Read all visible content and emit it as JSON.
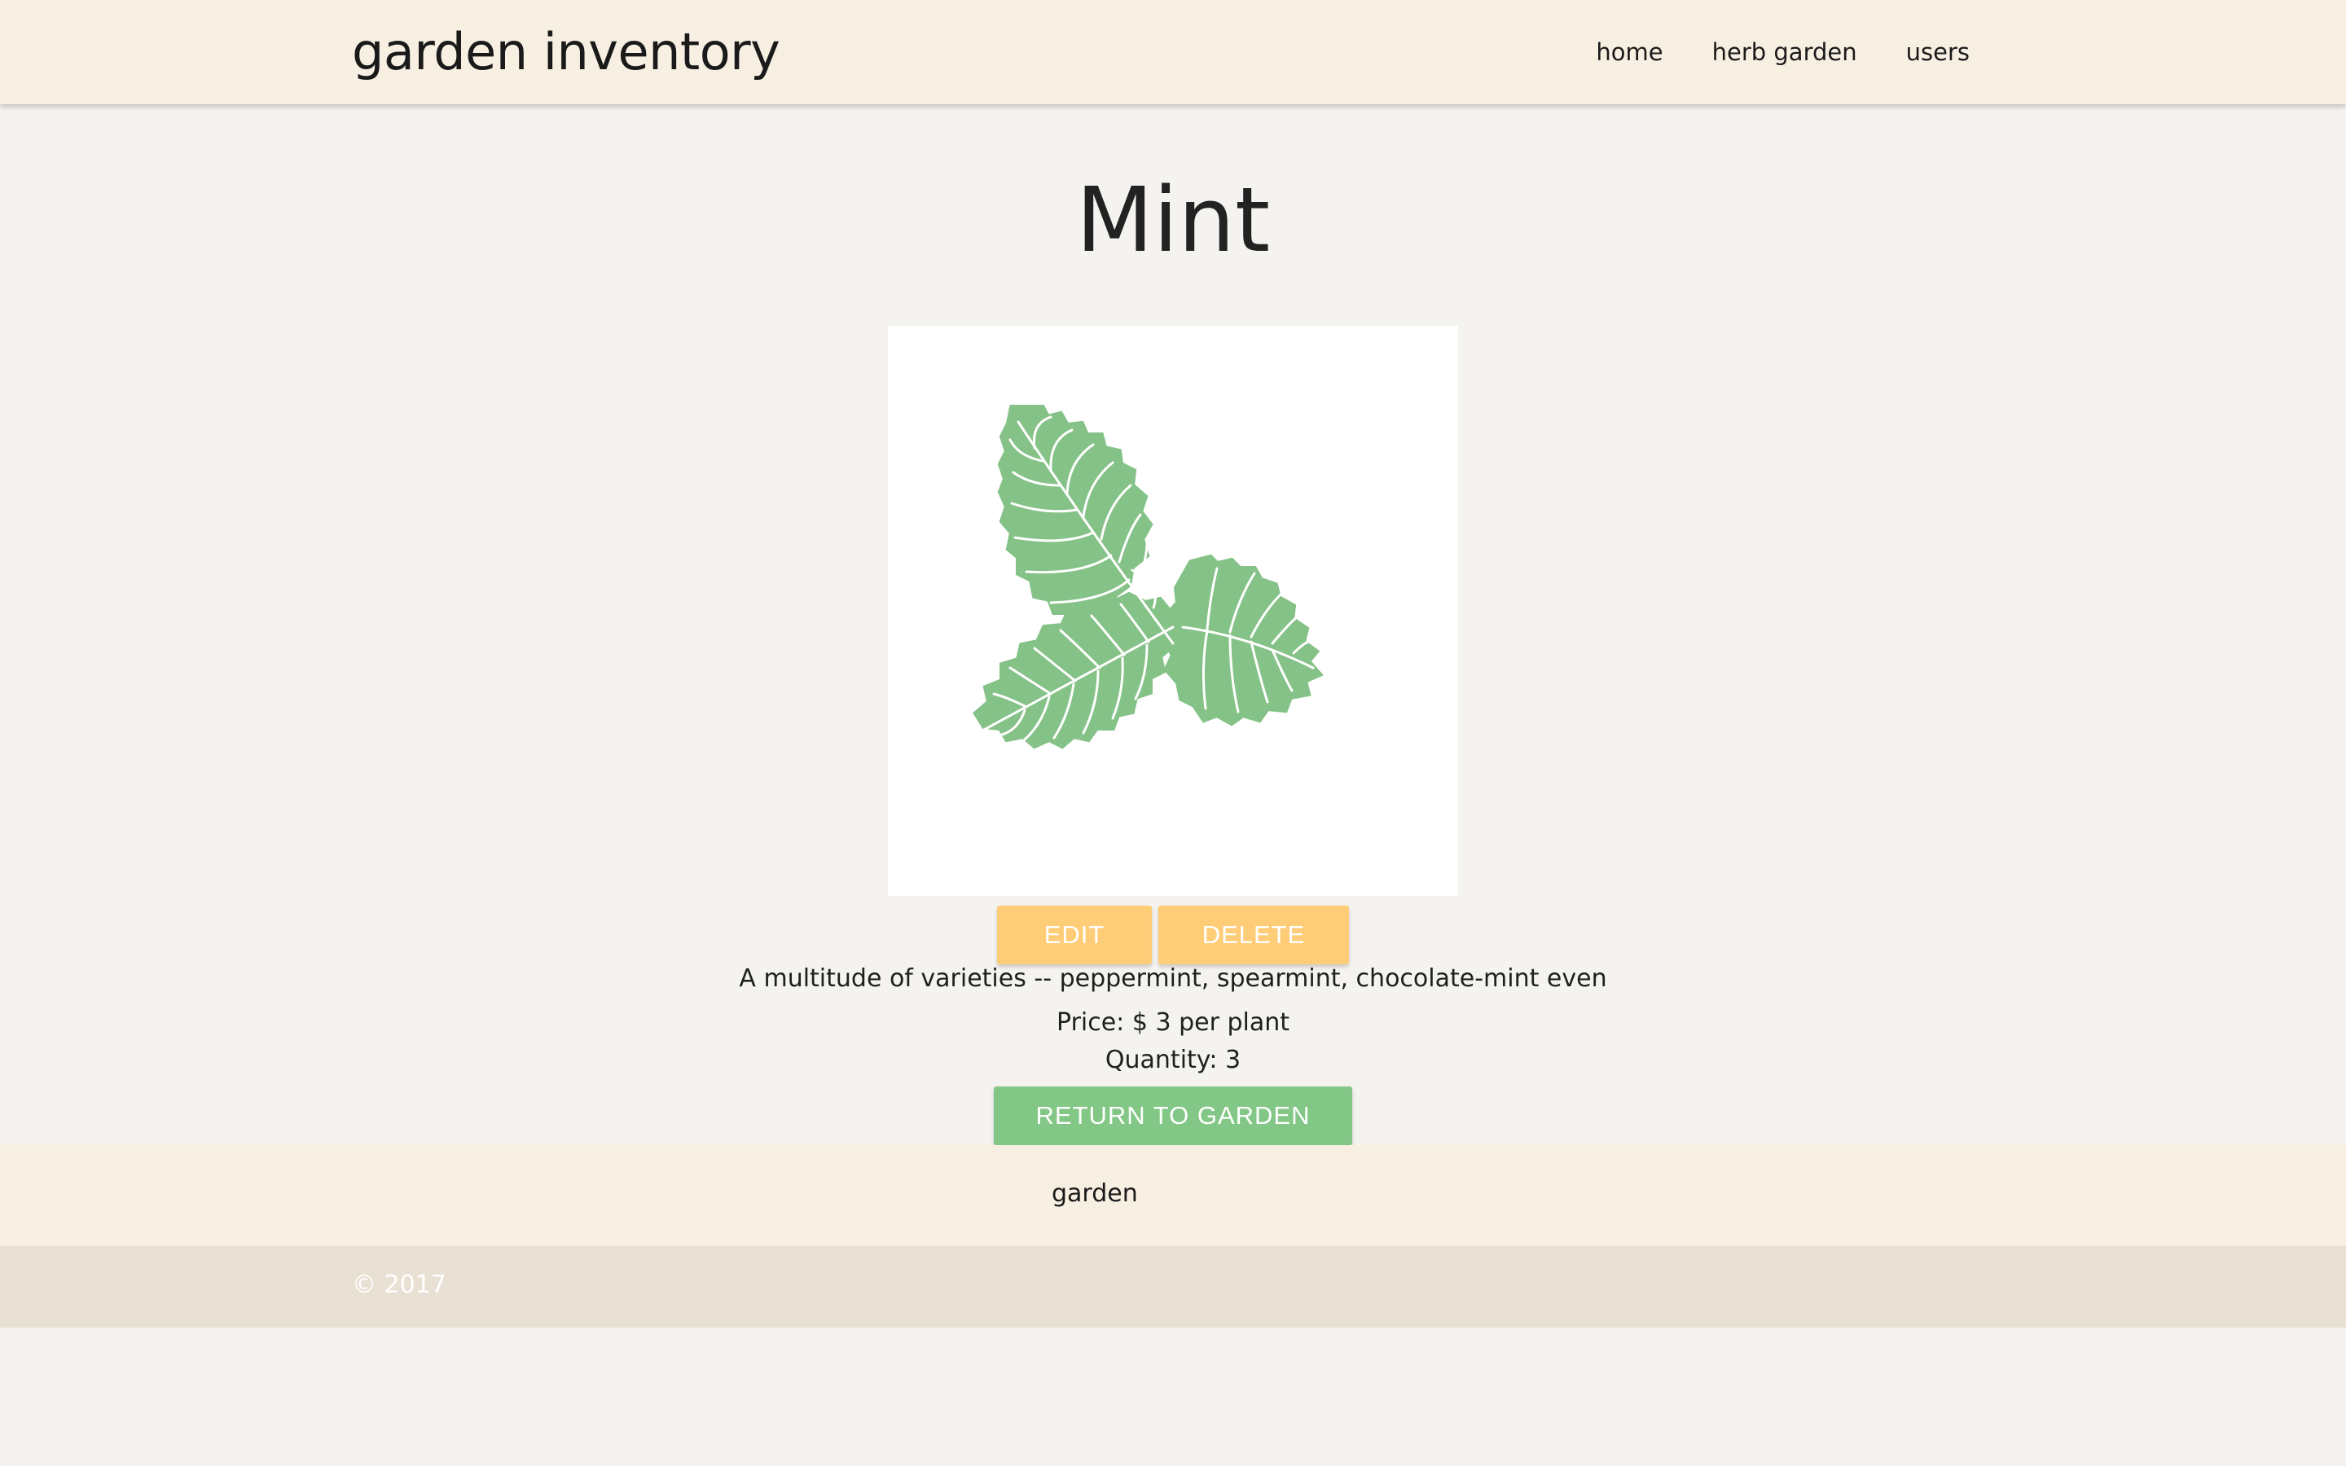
{
  "navbar": {
    "brand": "garden inventory",
    "links": [
      "home",
      "herb garden",
      "users"
    ]
  },
  "plant": {
    "name": "Mint",
    "image": "mint-leaves-image",
    "description": "A multitude of varieties -- peppermint, spearmint, chocolate-mint even",
    "price": "Price: $ 3 per plant",
    "quantity": "Quantity: 3"
  },
  "actions": {
    "edit": "EDIT",
    "delete": "DELETE",
    "return": "RETURN TO GARDEN"
  },
  "footer": {
    "link": "garden",
    "copyright": "© 2017"
  },
  "colors": {
    "header_bg": "#f7efe2",
    "page_bg": "#f5f3ef",
    "warning_button": "#ffcd77",
    "success_button": "#82c785",
    "leaf": "#85c287"
  }
}
